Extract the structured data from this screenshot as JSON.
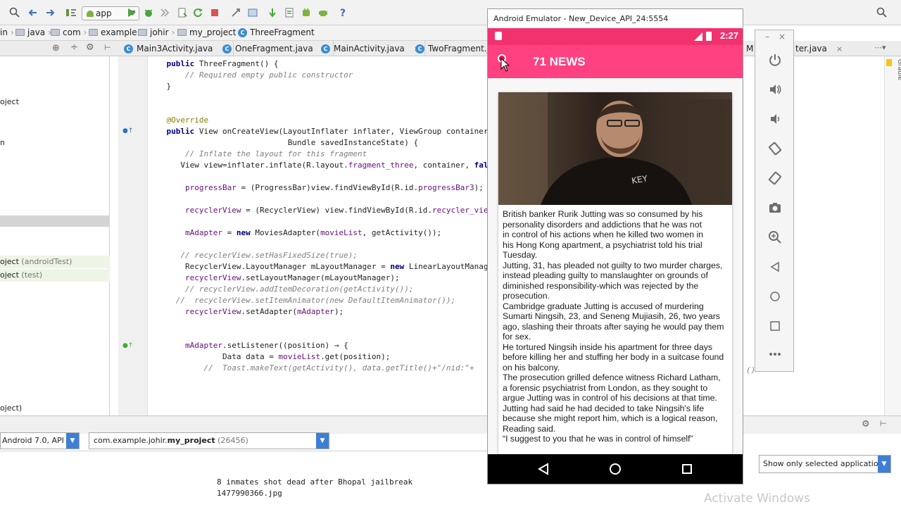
{
  "toolbar": {
    "run_config": "app",
    "icons": [
      "search-icon",
      "undo-icon",
      "redo-icon",
      "make-icon",
      "run-icon",
      "debug-icon",
      "step-icon",
      "apply-changes-icon",
      "rerun-icon",
      "stop-icon",
      "structure-icon",
      "sdk-icon",
      "sync-icon",
      "device-monitor-icon",
      "avd-icon",
      "help-icon"
    ]
  },
  "breadcrumb": {
    "items": [
      "in",
      "java",
      "com",
      "example",
      "johir",
      "my_project",
      "ThreeFragment"
    ]
  },
  "tabs": [
    {
      "label": "Main3Activity.java",
      "active": false
    },
    {
      "label": "OneFragment.java",
      "active": false
    },
    {
      "label": "MainActivity.java",
      "active": false
    },
    {
      "label": "TwoFragment.java",
      "active": false
    },
    {
      "label": "M",
      "active": false
    },
    {
      "label": "ter.java",
      "active": false
    }
  ],
  "project_tree": {
    "rows": [
      {
        "label": "oject",
        "suffix": ""
      },
      {
        "label": "n",
        "suffix": ""
      },
      {
        "label": "oject",
        "suffix": "(androidTest)"
      },
      {
        "label": "oject",
        "suffix": "(test)"
      },
      {
        "label": "oject)",
        "suffix": ""
      }
    ]
  },
  "code": {
    "lines": [
      {
        "indent": "    ",
        "parts": [
          [
            "kw",
            "public "
          ],
          [
            "pl",
            "ThreeFragment() {"
          ]
        ]
      },
      {
        "indent": "        ",
        "parts": [
          [
            "cm",
            "// Required empty public constructor"
          ]
        ]
      },
      {
        "indent": "    ",
        "parts": [
          [
            "pl",
            "}"
          ]
        ]
      },
      {
        "indent": "    ",
        "parts": [
          [
            "an",
            "@Override"
          ]
        ]
      },
      {
        "indent": "    ",
        "parts": [
          [
            "kw",
            "public "
          ],
          [
            "pl",
            "View onCreateView(LayoutInflater inflater, ViewGroup container,"
          ]
        ]
      },
      {
        "indent": "                              ",
        "parts": [
          [
            "pl",
            "Bundle savedInstanceState) {"
          ]
        ]
      },
      {
        "indent": "        ",
        "parts": [
          [
            "cm",
            "// Inflate the layout for this fragment"
          ]
        ]
      },
      {
        "indent": "       ",
        "parts": [
          [
            "pl",
            "View view=inflater.inflate(R.layout."
          ],
          [
            "fd",
            "fragment_three"
          ],
          [
            "pl",
            ", container, "
          ],
          [
            "kw",
            "fal"
          ]
        ]
      },
      {
        "indent": "        ",
        "parts": [
          [
            "fd",
            "progressBar"
          ],
          [
            "pl",
            " = (ProgressBar)view.findViewById(R.id."
          ],
          [
            "fd",
            "progressBar3"
          ],
          [
            "pl",
            ");"
          ]
        ]
      },
      {
        "indent": "        ",
        "parts": [
          [
            "fd",
            "recyclerView"
          ],
          [
            "pl",
            " = (RecyclerView) view.findViewById(R.id."
          ],
          [
            "fd",
            "recycler_vie"
          ]
        ]
      },
      {
        "indent": "        ",
        "parts": [
          [
            "fd",
            "mAdapter"
          ],
          [
            "pl",
            " = "
          ],
          [
            "kw",
            "new "
          ],
          [
            "pl",
            "MoviesAdapter("
          ],
          [
            "fd",
            "movieList"
          ],
          [
            "pl",
            ", getActivity());"
          ]
        ]
      },
      {
        "indent": "       ",
        "parts": [
          [
            "cm",
            "// recyclerView.setHasFixedSize(true);"
          ]
        ]
      },
      {
        "indent": "        ",
        "parts": [
          [
            "pl",
            "RecyclerView.LayoutManager mLayoutManager = "
          ],
          [
            "kw",
            "new "
          ],
          [
            "pl",
            "LinearLayoutManag"
          ]
        ]
      },
      {
        "indent": "        ",
        "parts": [
          [
            "fd",
            "recyclerView"
          ],
          [
            "pl",
            ".setLayoutManager(mLayoutManager);"
          ]
        ]
      },
      {
        "indent": "        ",
        "parts": [
          [
            "cm",
            "// recyclerView.addItemDecoration(getActivity());"
          ]
        ]
      },
      {
        "indent": "      ",
        "parts": [
          [
            "cm",
            "//  recyclerView.setItemAnimator(new DefaultItemAnimator());"
          ]
        ]
      },
      {
        "indent": "        ",
        "parts": [
          [
            "fd",
            "recyclerView"
          ],
          [
            "pl",
            ".setAdapter("
          ],
          [
            "fd",
            "mAdapter"
          ],
          [
            "pl",
            ");"
          ]
        ]
      },
      {
        "indent": "        ",
        "parts": [
          [
            "fd",
            "mAdapter"
          ],
          [
            "pl",
            ".setListener((position) → {"
          ]
        ]
      },
      {
        "indent": "                ",
        "parts": [
          [
            "pl",
            "Data data = "
          ],
          [
            "fd",
            "movieList"
          ],
          [
            "pl",
            ".get(position);"
          ]
        ]
      },
      {
        "indent": "            ",
        "parts": [
          [
            "cm",
            "//  Toast.makeText(getActivity(), data.getTitle()+\"/nid:\"+"
          ]
        ]
      }
    ],
    "right_overflow": "()"
  },
  "run_bar": {
    "device": "Android 7.0, API 24",
    "process_prefix": "com.example.johir.",
    "process_name": "my_project",
    "process_pid": "(26456)",
    "logcat_filter": "Show only selected application"
  },
  "logcat": {
    "lines": [
      "8 inmates shot dead after Bhopal jailbreak",
      "1477990366.jpg"
    ]
  },
  "watermark": "Activate Windows",
  "emulator": {
    "window_title": "Android Emulator - New_Device_API_24:5554",
    "status_time": "2:27",
    "app_title": "71 NEWS",
    "article_text": "British banker Rurik Jutting was so consumed by his\npersonality disorders and addictions that he was not\nin control of his actions when he killed two women in\nhis Hong Kong apartment, a psychiatrist told his trial\nTuesday.\nJutting, 31, has pleaded not guilty to two murder charges,\ninstead pleading guilty to manslaughter on grounds of\ndiminished responsibility-which was rejected by the\nprosecution.\nCambridge graduate Jutting is accused of murdering\nSumarti Ningsih, 23, and Seneng Mujiasih, 26, two years\nago, slashing their throats after saying he would pay them\nfor sex.\nHe tortured Ningsih inside his apartment for three days\nbefore killing her and stuffing her body in a suitcase found\non his balcony.\nThe prosecution grilled defence witness Richard Latham,\na forensic psychiatrist from London, as they sought to\nargue Jutting was in control of his decisions at that time.\nJutting had said he had decided to take Ningsih's life\nbecause she might report him, which is a logical reason,\nReading said.\n“I suggest to you that he was in control of himself”",
    "side_controls": [
      "power-icon",
      "volume-up-icon",
      "volume-down-icon",
      "rotate-left-icon",
      "rotate-right-icon",
      "camera-icon",
      "zoom-icon",
      "back-icon",
      "home-icon",
      "overview-icon",
      "more-icon"
    ],
    "colors": {
      "status_bar": "#f2326f",
      "app_bar": "#ff4081"
    }
  }
}
